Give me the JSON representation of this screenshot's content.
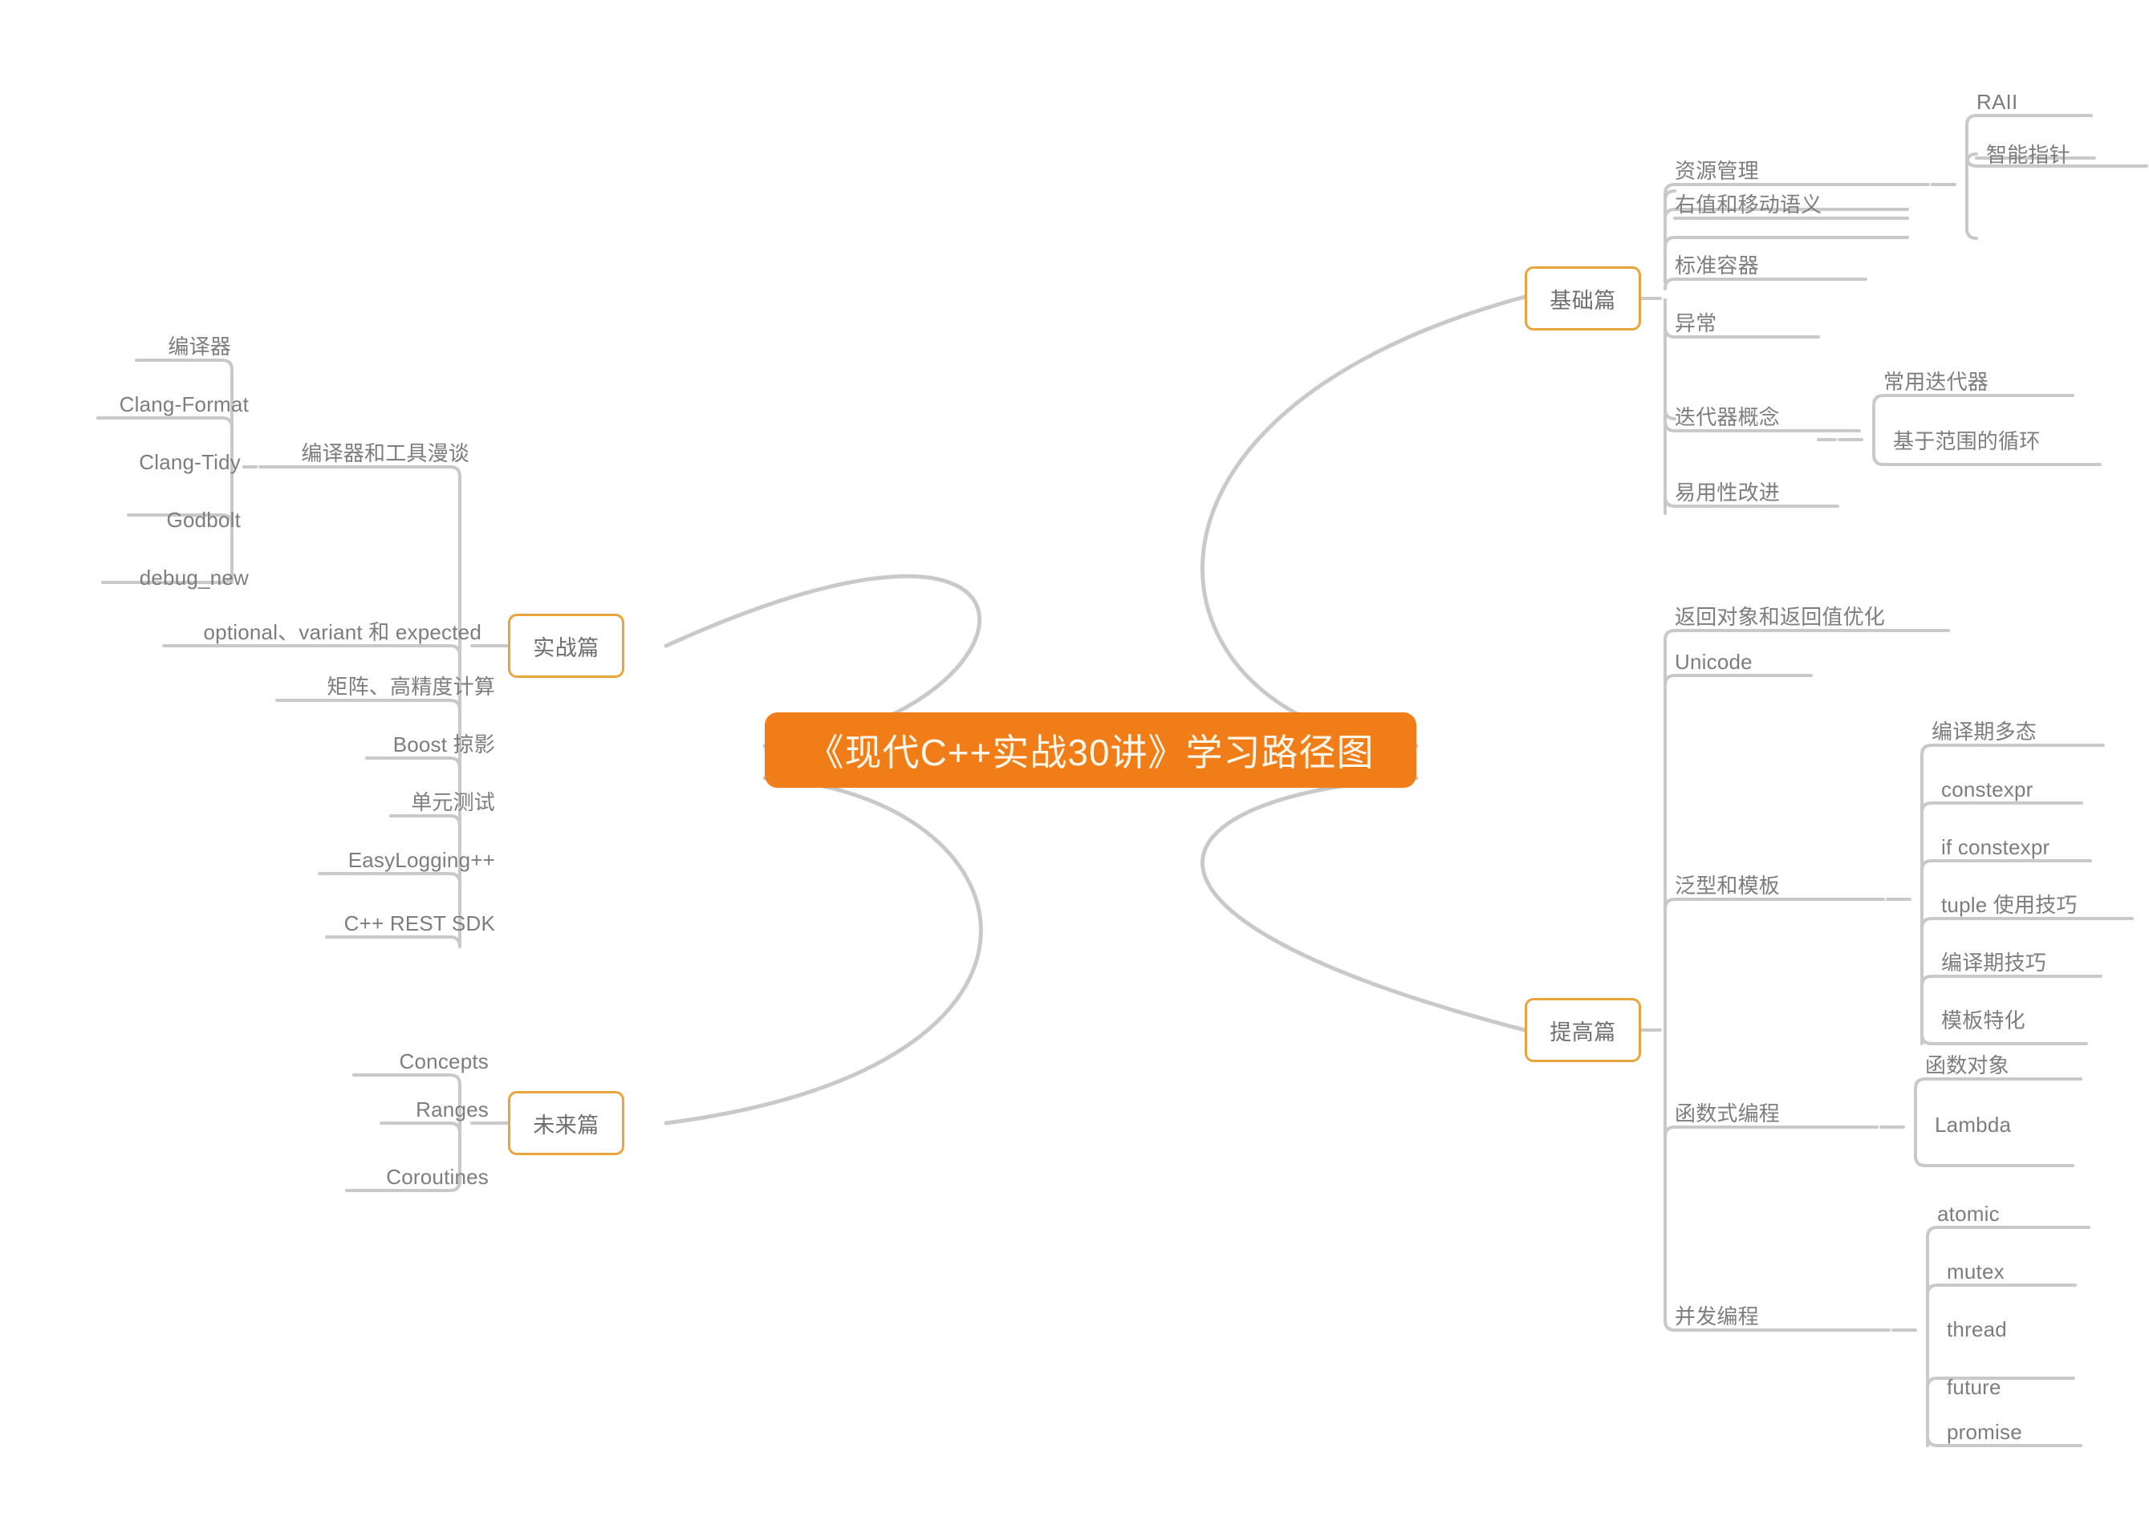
{
  "diagram": {
    "title": "《现代C++实战30讲》学习路径图",
    "background": "#ffffff",
    "colors": {
      "root_fill": "#F07D18",
      "root_text": "#FFF6EA",
      "branch_border": "#E9A53C",
      "branch_fill": "#ffffff",
      "topic_text": "#7D7D7D",
      "connector": "#C9C9C9"
    }
  },
  "root": {
    "label": "《现代C++实战30讲》学习路径图"
  },
  "branches": {
    "jichu": {
      "label": "基础篇",
      "children": [
        {
          "label": "资源管理",
          "children": [
            {
              "label": "RAII"
            },
            {
              "label": "智能指针"
            }
          ]
        },
        {
          "label": "右值和移动语义"
        },
        {
          "label": "标准容器"
        },
        {
          "label": "异常"
        },
        {
          "label": "迭代器概念",
          "children": [
            {
              "label": "常用迭代器"
            },
            {
              "label": "基于范围的循环"
            }
          ]
        },
        {
          "label": "易用性改进"
        }
      ]
    },
    "tigao": {
      "label": "提高篇",
      "children": [
        {
          "label": "返回对象和返回值优化"
        },
        {
          "label": "Unicode"
        },
        {
          "label": "泛型和模板",
          "children": [
            {
              "label": "编译期多态"
            },
            {
              "label": "constexpr"
            },
            {
              "label": "if constexpr"
            },
            {
              "label": "tuple 使用技巧"
            },
            {
              "label": "编译期技巧"
            },
            {
              "label": "模板特化"
            }
          ]
        },
        {
          "label": "函数式编程",
          "children": [
            {
              "label": "函数对象"
            },
            {
              "label": "Lambda"
            }
          ]
        },
        {
          "label": "并发编程",
          "children": [
            {
              "label": "atomic"
            },
            {
              "label": "mutex"
            },
            {
              "label": "thread"
            },
            {
              "label": "future"
            },
            {
              "label": "promise"
            }
          ]
        }
      ]
    },
    "shizhan": {
      "label": "实战篇",
      "children": [
        {
          "label": "编译器和工具漫谈",
          "children": [
            {
              "label": "编译器"
            },
            {
              "label": "Clang-Format"
            },
            {
              "label": "Clang-Tidy"
            },
            {
              "label": "Godbolt"
            },
            {
              "label": "debug_new"
            }
          ]
        },
        {
          "label": "optional、variant 和 expected"
        },
        {
          "label": "矩阵、高精度计算"
        },
        {
          "label": "Boost 掠影"
        },
        {
          "label": "单元测试"
        },
        {
          "label": "EasyLogging++"
        },
        {
          "label": "C++ REST SDK"
        }
      ]
    },
    "weilai": {
      "label": "未来篇",
      "children": [
        {
          "label": "Concepts"
        },
        {
          "label": "Ranges"
        },
        {
          "label": "Coroutines"
        }
      ]
    }
  }
}
